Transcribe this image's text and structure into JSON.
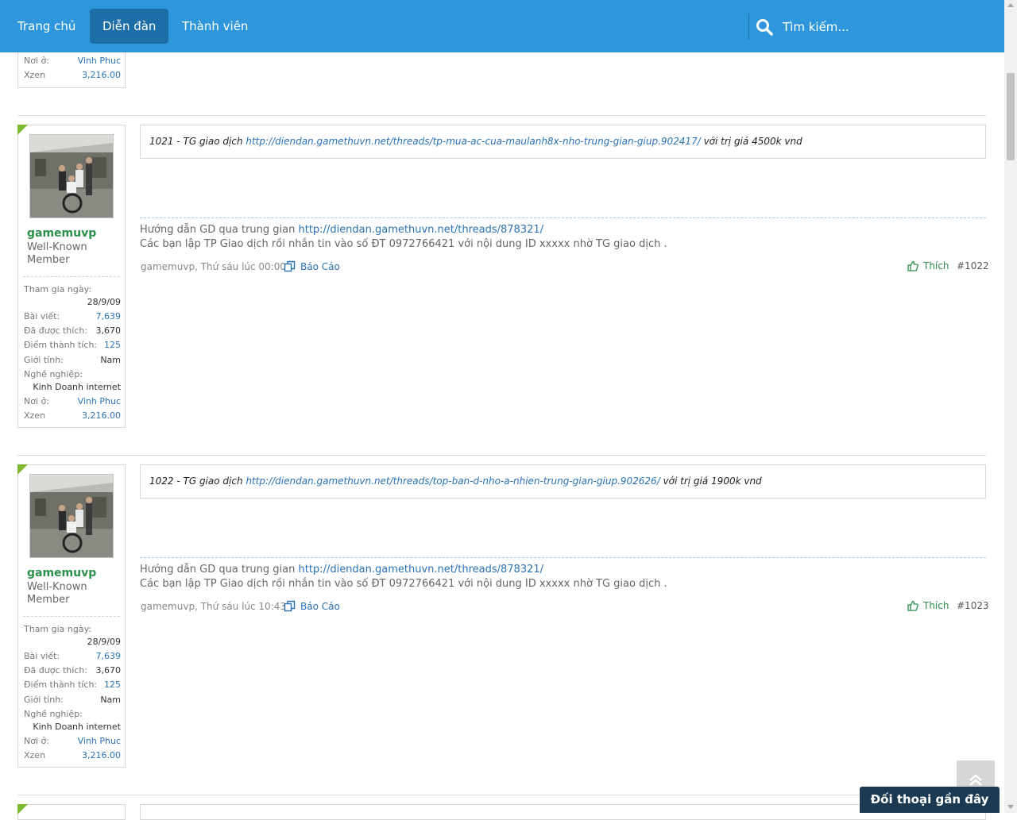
{
  "nav": {
    "tabs": [
      {
        "label": "Trang chủ"
      },
      {
        "label": "Diễn đàn"
      },
      {
        "label": "Thành viên"
      }
    ],
    "search_placeholder": "Tìm kiếm..."
  },
  "top_partial": {
    "location_label": "Nơi ở:",
    "location_value": "Vinh Phuc",
    "xzen_label": "Xzen",
    "xzen_value": "3,216.00"
  },
  "posts": [
    {
      "username": "gamemuvp",
      "user_title": "Well-Known Member",
      "joined_label": "Tham gia ngày:",
      "joined_value": "28/9/09",
      "posts_label": "Bài viết:",
      "posts_value": "7,639",
      "likes_label": "Đã được thích:",
      "likes_value": "3,670",
      "points_label": "Điểm thành tích:",
      "points_value": "125",
      "gender_label": "Giới tính:",
      "gender_value": "Nam",
      "job_label": "Nghề nghiệp:",
      "job_value": "Kinh Doanh internet",
      "location_label": "Nơi ở:",
      "location_value": "Vinh Phuc",
      "xzen_label": "Xzen",
      "xzen_value": "3,216.00",
      "message_prefix": "1021 - TG giao dịch ",
      "message_link": "http://diendan.gamethuvn.net/threads/tp-mua-ac-cua-maulanh8x-nho-trung-gian-giup.902417/",
      "message_suffix": " với trị giá 4500k vnd",
      "sig_prefix": "Hướng dẫn GD qua trung gian ",
      "sig_link": "http://diendan.gamethuvn.net/threads/878321/",
      "sig_line2": "Các bạn lập TP Giao dịch rồi nhắn tin vào số ĐT 0972766421 với nội dung ID xxxxx nhờ TG giao dịch .",
      "meta": "gamemuvp, Thứ sáu lúc 00:00",
      "report_label": "Báo Cáo",
      "like_label": "Thích",
      "post_number": "#1022"
    },
    {
      "username": "gamemuvp",
      "user_title": "Well-Known Member",
      "joined_label": "Tham gia ngày:",
      "joined_value": "28/9/09",
      "posts_label": "Bài viết:",
      "posts_value": "7,639",
      "likes_label": "Đã được thích:",
      "likes_value": "3,670",
      "points_label": "Điểm thành tích:",
      "points_value": "125",
      "gender_label": "Giới tính:",
      "gender_value": "Nam",
      "job_label": "Nghề nghiệp:",
      "job_value": "Kinh Doanh internet",
      "location_label": "Nơi ở:",
      "location_value": "Vinh Phuc",
      "xzen_label": "Xzen",
      "xzen_value": "3,216.00",
      "message_prefix": "1022 - TG giao dịch ",
      "message_link": "http://diendan.gamethuvn.net/threads/top-ban-d-nho-a-nhien-trung-gian-giup.902626/",
      "message_suffix": " với trị giá 1900k vnd",
      "sig_prefix": "Hướng dẫn GD qua trung gian ",
      "sig_link": "http://diendan.gamethuvn.net/threads/878321/",
      "sig_line2": "Các bạn lập TP Giao dịch rồi nhắn tin vào số ĐT 0972766421 với nội dung ID xxxxx nhờ TG giao dịch .",
      "meta": "gamemuvp, Thứ sáu lúc 10:43",
      "report_label": "Báo Cáo",
      "like_label": "Thích",
      "post_number": "#1023"
    }
  ],
  "chat_bar_label": "Đối thoại gần đây",
  "colors": {
    "nav_bg": "#2e97dc",
    "nav_active": "#1d6ea7",
    "username": "#2c8f4c",
    "link": "#2a72b5",
    "chat_bg": "#1b3a52"
  }
}
